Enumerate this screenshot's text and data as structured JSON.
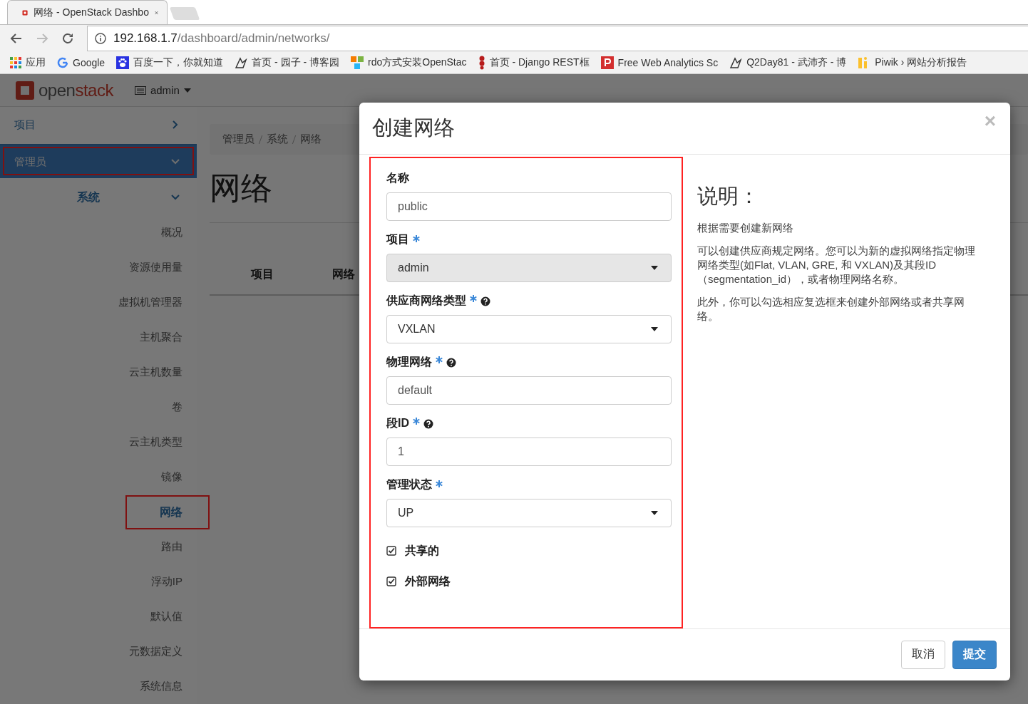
{
  "browser": {
    "tab_title": "网络 - OpenStack Dashbo",
    "url_host": "192.168.1.7",
    "url_path": "/dashboard/admin/networks/",
    "bookmarks": [
      {
        "label": "应用"
      },
      {
        "label": "Google"
      },
      {
        "label": "百度一下，你就知道"
      },
      {
        "label": "首页 - 园子 - 博客园"
      },
      {
        "label": "rdo方式安装OpenStac"
      },
      {
        "label": "首页 - Django REST框"
      },
      {
        "label": "Free Web Analytics Sc"
      },
      {
        "label": "Q2Day81 - 武沛齐 - 博"
      },
      {
        "label": "Piwik › 网站分析报告"
      }
    ]
  },
  "header": {
    "logo_text_a": "open",
    "logo_text_b": "stack",
    "project_menu": "admin"
  },
  "sidebar": {
    "items": [
      {
        "label": "项目",
        "kind": "panel",
        "expanded": false,
        "selected": false,
        "highlighted": false
      },
      {
        "label": "管理员",
        "kind": "panel",
        "expanded": true,
        "selected": true,
        "highlighted": true
      },
      {
        "label": "系统",
        "kind": "group",
        "expanded": true,
        "selected": false,
        "highlighted": false
      },
      {
        "label": "概况",
        "kind": "link",
        "selected": false,
        "highlighted": false
      },
      {
        "label": "资源使用量",
        "kind": "link",
        "selected": false,
        "highlighted": false
      },
      {
        "label": "虚拟机管理器",
        "kind": "link",
        "selected": false,
        "highlighted": false
      },
      {
        "label": "主机聚合",
        "kind": "link",
        "selected": false,
        "highlighted": false
      },
      {
        "label": "云主机数量",
        "kind": "link",
        "selected": false,
        "highlighted": false
      },
      {
        "label": "卷",
        "kind": "link",
        "selected": false,
        "highlighted": false
      },
      {
        "label": "云主机类型",
        "kind": "link",
        "selected": false,
        "highlighted": false
      },
      {
        "label": "镜像",
        "kind": "link",
        "selected": false,
        "highlighted": false
      },
      {
        "label": "网络",
        "kind": "link",
        "selected": true,
        "highlighted": true
      },
      {
        "label": "路由",
        "kind": "link",
        "selected": false,
        "highlighted": false
      },
      {
        "label": "浮动IP",
        "kind": "link",
        "selected": false,
        "highlighted": false
      },
      {
        "label": "默认值",
        "kind": "link",
        "selected": false,
        "highlighted": false
      },
      {
        "label": "元数据定义",
        "kind": "link",
        "selected": false,
        "highlighted": false
      },
      {
        "label": "系统信息",
        "kind": "link",
        "selected": false,
        "highlighted": false
      }
    ]
  },
  "breadcrumb": [
    "管理员",
    "系统",
    "网络"
  ],
  "page_title": "网络",
  "table": {
    "columns": [
      "项目",
      "网络"
    ]
  },
  "modal": {
    "title": "创建网络",
    "close": "×",
    "form": {
      "highlighted": true,
      "fields": [
        {
          "label": "名称",
          "kind": "text",
          "required": false,
          "help": false,
          "value": "public",
          "disabled": false
        },
        {
          "label": "项目",
          "kind": "select",
          "required": true,
          "help": false,
          "value": "admin",
          "disabled": true
        },
        {
          "label": "供应商网络类型",
          "kind": "select",
          "required": true,
          "help": true,
          "value": "VXLAN",
          "disabled": false
        },
        {
          "label": "物理网络",
          "kind": "text",
          "required": true,
          "help": true,
          "value": "default",
          "disabled": false
        },
        {
          "label": "段ID",
          "kind": "text",
          "required": true,
          "help": true,
          "value": "1",
          "disabled": false
        },
        {
          "label": "管理状态",
          "kind": "select",
          "required": true,
          "help": false,
          "value": "UP",
          "disabled": false
        }
      ],
      "checkboxes": [
        {
          "label": "共享的",
          "checked": true
        },
        {
          "label": "外部网络",
          "checked": true
        }
      ]
    },
    "help": {
      "heading": "说明：",
      "paragraphs": [
        "根据需要创建新网络",
        "可以创建供应商规定网络。您可以为新的虚拟网络指定物理网络类型(如Flat, VLAN, GRE, 和 VXLAN)及其段ID（segmentation_id），或者物理网络名称。",
        "此外，你可以勾选相应复选框来创建外部网络或者共享网络。"
      ]
    },
    "buttons": [
      {
        "label": "取消",
        "kind": "default"
      },
      {
        "label": "提交",
        "kind": "primary"
      }
    ]
  }
}
